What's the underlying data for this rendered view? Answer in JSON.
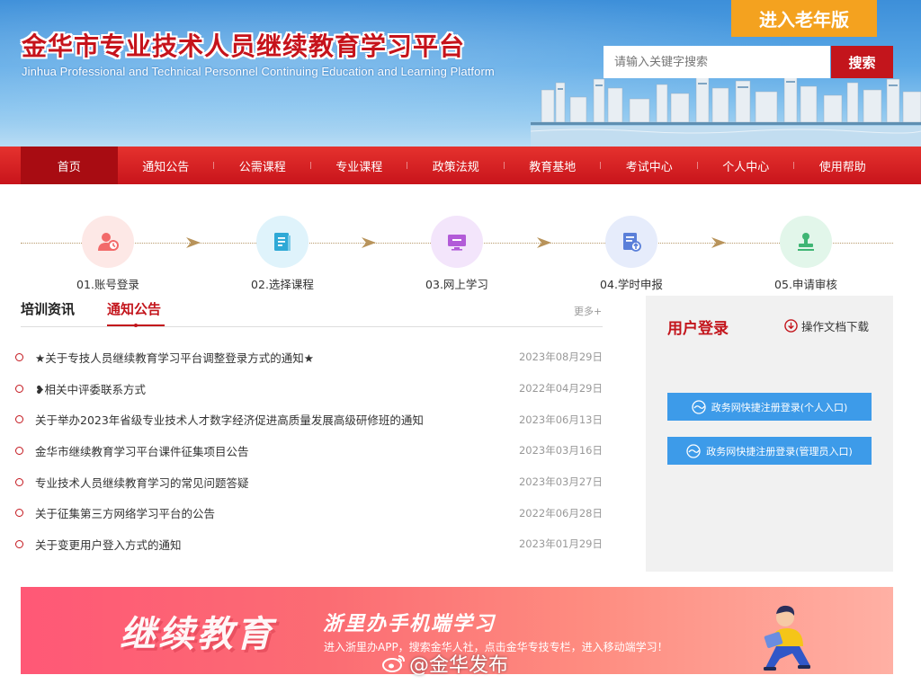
{
  "header": {
    "title": "金华市专业技术人员继续教育学习平台",
    "subtitle": "Jinhua Professional and Technical Personnel Continuing Education and Learning Platform",
    "elder_mode": "进入老年版",
    "search_placeholder": "请输入关键字搜索",
    "search_button": "搜索"
  },
  "nav": {
    "items": [
      "首页",
      "通知公告",
      "公需课程",
      "专业课程",
      "政策法规",
      "教育基地",
      "考试中心",
      "个人中心",
      "使用帮助"
    ],
    "active_index": 0
  },
  "steps": [
    {
      "label": "01.账号登录",
      "icon": "user-login-icon",
      "color": "#f26a6a",
      "bg": "#fde8e6"
    },
    {
      "label": "02.选择课程",
      "icon": "course-book-icon",
      "color": "#2fa9d6",
      "bg": "#dff3fb"
    },
    {
      "label": "03.网上学习",
      "icon": "monitor-icon",
      "color": "#b25bd8",
      "bg": "#f3e5fb"
    },
    {
      "label": "04.学时申报",
      "icon": "report-upload-icon",
      "color": "#5a7fd9",
      "bg": "#e6ecfb"
    },
    {
      "label": "05.申请审核",
      "icon": "approval-stamp-icon",
      "color": "#3fb574",
      "bg": "#e2f6ea"
    }
  ],
  "news": {
    "tabs": [
      "培训资讯",
      "通知公告"
    ],
    "active_tab": 1,
    "more": "更多+",
    "items": [
      {
        "title": "★关于专技人员继续教育学习平台调整登录方式的通知★",
        "date": "2023年08月29日"
      },
      {
        "title": "❥相关中评委联系方式",
        "date": "2022年04月29日"
      },
      {
        "title": "关于举办2023年省级专业技术人才数字经济促进高质量发展高级研修班的通知",
        "date": "2023年06月13日"
      },
      {
        "title": "金华市继续教育学习平台课件征集项目公告",
        "date": "2023年03月16日"
      },
      {
        "title": "专业技术人员继续教育学习的常见问题答疑",
        "date": "2023年03月27日"
      },
      {
        "title": "关于征集第三方网络学习平台的公告",
        "date": "2022年06月28日"
      },
      {
        "title": "关于变更用户登入方式的通知",
        "date": "2023年01月29日"
      }
    ]
  },
  "login": {
    "title": "用户登录",
    "doc_download": "操作文档下载",
    "personal_button": "政务网快捷注册登录(个人入口)",
    "admin_button": "政务网快捷注册登录(管理员入口)"
  },
  "banner": {
    "big_text": "继续教育",
    "headline": "浙里办手机端学习",
    "description": "进入浙里办APP，搜索金华人社，点击金华专技专栏，进入移动端学习！"
  },
  "watermark": "@金华发布",
  "colors": {
    "brand_red": "#c3151c",
    "nav_red": "#d41f22",
    "accent_orange": "#f4a21f",
    "login_blue": "#3d9be9"
  }
}
